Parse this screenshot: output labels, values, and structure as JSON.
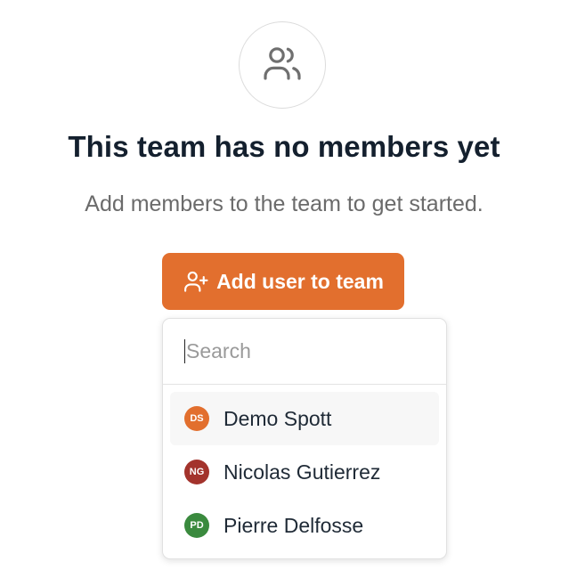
{
  "empty_state": {
    "icon": "users-icon",
    "title": "This team has no members yet",
    "subtitle": "Add members to the team to get started."
  },
  "add_button": {
    "label": "Add user to team",
    "icon": "user-plus-icon",
    "color": "#e26f2e"
  },
  "dropdown": {
    "search": {
      "placeholder": "Search",
      "value": ""
    },
    "users": [
      {
        "initials": "DS",
        "name": "Demo Spott",
        "avatar_color": "#e26f2e",
        "highlighted": true
      },
      {
        "initials": "NG",
        "name": "Nicolas Gutierrez",
        "avatar_color": "#a3332c",
        "highlighted": false
      },
      {
        "initials": "PD",
        "name": "Pierre Delfosse",
        "avatar_color": "#3a8a3e",
        "highlighted": false
      }
    ]
  }
}
